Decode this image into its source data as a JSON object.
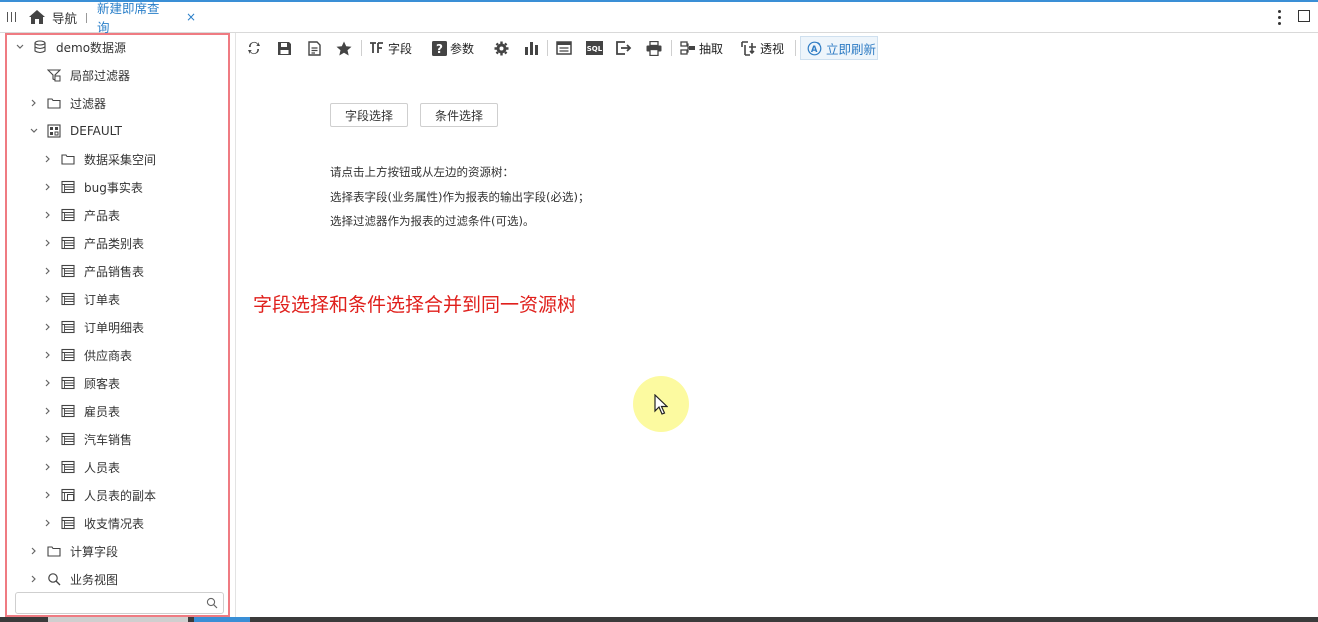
{
  "tabs": {
    "nav_label": "导航",
    "active_label": "新建即席查询",
    "close_glyph": "×"
  },
  "tree": {
    "items": [
      {
        "label": "demo数据源",
        "icon": "database-icon"
      },
      {
        "label": "局部过滤器",
        "icon": "local-filter-icon"
      },
      {
        "label": "过滤器",
        "icon": "folder-icon"
      },
      {
        "label": "DEFAULT",
        "icon": "schema-icon"
      },
      {
        "label": "数据采集空间",
        "icon": "folder-icon"
      },
      {
        "label": "bug事实表",
        "icon": "table-icon"
      },
      {
        "label": "产品表",
        "icon": "table-icon"
      },
      {
        "label": "产品类别表",
        "icon": "table-icon"
      },
      {
        "label": "产品销售表",
        "icon": "table-icon"
      },
      {
        "label": "订单表",
        "icon": "table-icon"
      },
      {
        "label": "订单明细表",
        "icon": "table-icon"
      },
      {
        "label": "供应商表",
        "icon": "table-icon"
      },
      {
        "label": "顾客表",
        "icon": "table-icon"
      },
      {
        "label": "雇员表",
        "icon": "table-icon"
      },
      {
        "label": "汽车销售",
        "icon": "table-icon"
      },
      {
        "label": "人员表",
        "icon": "table-icon"
      },
      {
        "label": "人员表的副本",
        "icon": "table-copy-icon"
      },
      {
        "label": "收支情况表",
        "icon": "table-icon"
      },
      {
        "label": "计算字段",
        "icon": "folder-icon"
      },
      {
        "label": "业务视图",
        "icon": "search-view-icon"
      }
    ],
    "search_placeholder": ""
  },
  "toolbar": {
    "field_label": "字段",
    "param_label": "参数",
    "extract_label": "抽取",
    "pivot_label": "透视",
    "refresh_label": "立即刷新"
  },
  "content": {
    "field_select_button": "字段选择",
    "condition_select_button": "条件选择",
    "hint_line1": "请点击上方按钮或从左边的资源树：",
    "hint_line2": "选择表字段(业务属性)作为报表的输出字段(必选)；",
    "hint_line3": "选择过滤器作为报表的过滤条件(可选)。",
    "annotation": "字段选择和条件选择合并到同一资源树"
  },
  "colors": {
    "accent": "#2a7fc9",
    "tree_border": "#ef7b82",
    "annotation": "#e0201c",
    "cursor_halo": "#fcfa96"
  }
}
